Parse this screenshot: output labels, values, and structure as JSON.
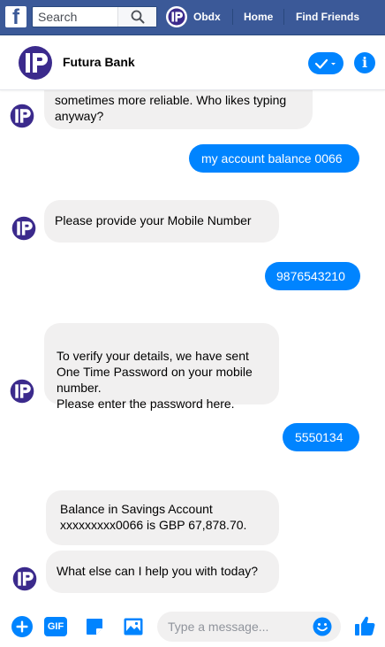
{
  "topbar": {
    "logo": "f",
    "search_placeholder": "Search",
    "profile_name": "Obdx",
    "home_label": "Home",
    "find_friends_label": "Find Friends"
  },
  "header": {
    "title": "Futura Bank"
  },
  "messages": [
    {
      "from": "bot",
      "text": "sometimes more reliable.  Who likes typing anyway?"
    },
    {
      "from": "user",
      "text": "my account balance 0066"
    },
    {
      "from": "bot",
      "text": "Please provide your Mobile Number"
    },
    {
      "from": "user",
      "text": "9876543210"
    },
    {
      "from": "bot",
      "text": "To verify your details, we have sent One Time Password on your mobile number.\nPlease enter the password here."
    },
    {
      "from": "user",
      "text": "5550134"
    },
    {
      "from": "bot",
      "text": "Balance in Savings Account xxxxxxxxx0066 is GBP 67,878.70."
    },
    {
      "from": "bot",
      "text": "What else can I help you with today?"
    }
  ],
  "composer": {
    "placeholder": "Type a message...",
    "gif_label": "GIF"
  },
  "colors": {
    "facebook_blue": "#3b5998",
    "messenger_blue": "#0084ff",
    "bot_bubble": "#f1f0f0",
    "brand_purple": "#3b2a8c"
  },
  "icons": [
    "search-icon",
    "check-icon",
    "info-icon",
    "add-icon",
    "gif-icon",
    "sticker-icon",
    "image-icon",
    "emoji-icon",
    "thumbs-up-icon"
  ]
}
